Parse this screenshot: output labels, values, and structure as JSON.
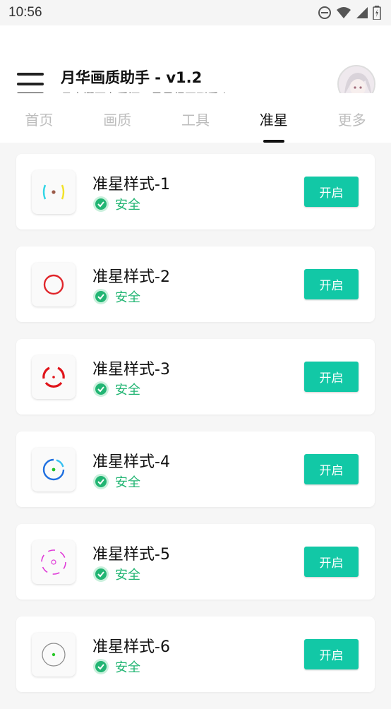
{
  "status_bar": {
    "time": "10:56",
    "icons": [
      "dnd-icon",
      "wifi-icon",
      "signal-icon",
      "battery-icon"
    ]
  },
  "header": {
    "title": "月华画质助手 - v1.2",
    "subtitle": "月亮溺死在爱河，星星得不到爱火。"
  },
  "tabs": [
    {
      "label": "首页"
    },
    {
      "label": "画质"
    },
    {
      "label": "工具"
    },
    {
      "label": "准星"
    },
    {
      "label": "更多"
    }
  ],
  "active_tab": "准星",
  "items": [
    {
      "title": "准星样式-1",
      "status": "安全",
      "button": "开启",
      "icon": "crosshair-brackets-icon"
    },
    {
      "title": "准星样式-2",
      "status": "安全",
      "button": "开启",
      "icon": "crosshair-red-circle-icon"
    },
    {
      "title": "准星样式-3",
      "status": "安全",
      "button": "开启",
      "icon": "crosshair-red-arcs-icon"
    },
    {
      "title": "准星样式-4",
      "status": "安全",
      "button": "开启",
      "icon": "crosshair-blue-ring-icon"
    },
    {
      "title": "准星样式-5",
      "status": "安全",
      "button": "开启",
      "icon": "crosshair-pink-dashed-icon"
    },
    {
      "title": "准星样式-6",
      "status": "安全",
      "button": "开启",
      "icon": "crosshair-grey-ring-icon"
    }
  ],
  "colors": {
    "accent": "#12c8a6",
    "safe": "#22b573"
  }
}
